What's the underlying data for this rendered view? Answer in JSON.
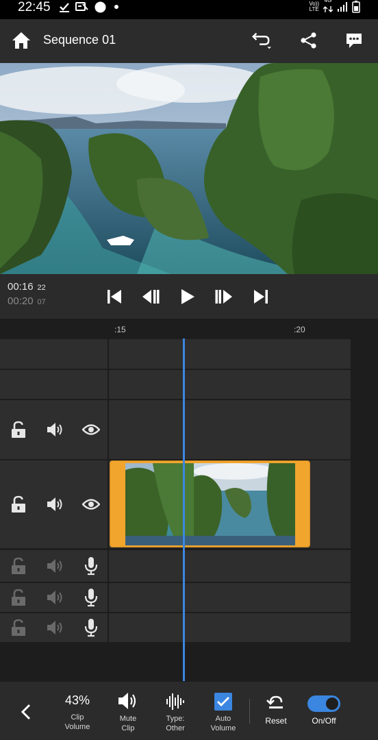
{
  "status_bar": {
    "time": "22:45",
    "left_icons": [
      "check-download-icon",
      "vpn-icon",
      "circle-icon",
      "dot-icon"
    ],
    "network_labels": [
      "Vo))",
      "LTE",
      "4G"
    ],
    "right_icons": [
      "data-arrows-icon",
      "signal-icon",
      "battery-icon"
    ]
  },
  "header": {
    "title": "Sequence 01",
    "icons": [
      "home-icon",
      "undo-icon",
      "share-icon",
      "feedback-icon"
    ]
  },
  "transport": {
    "current_time": "00:16",
    "current_frames": "22",
    "duration_time": "00:20",
    "duration_frames": "07",
    "buttons": [
      "skip-to-start",
      "step-back",
      "play",
      "step-forward",
      "skip-to-end"
    ]
  },
  "timeline": {
    "ruler_labels": [
      ":15",
      ":20"
    ],
    "video_tracks": [
      {
        "locked": false,
        "audio_on": true,
        "visible": true
      },
      {
        "locked": false,
        "audio_on": true,
        "visible": true,
        "has_clip": true
      }
    ],
    "audio_tracks": 3
  },
  "toolbar": {
    "clip_volume_value": "43%",
    "clip_volume_label": "Clip Volume",
    "mute_clip_label": "Mute Clip",
    "type_label": "Type: Other",
    "auto_volume_label": "Auto Volume",
    "auto_volume_checked": true,
    "reset_label": "Reset",
    "onoff_label": "On/Off",
    "onoff_state": true
  },
  "colors": {
    "accent": "#3b86e0",
    "clip_border": "#f1a52d",
    "panel": "#2e2e2e"
  }
}
